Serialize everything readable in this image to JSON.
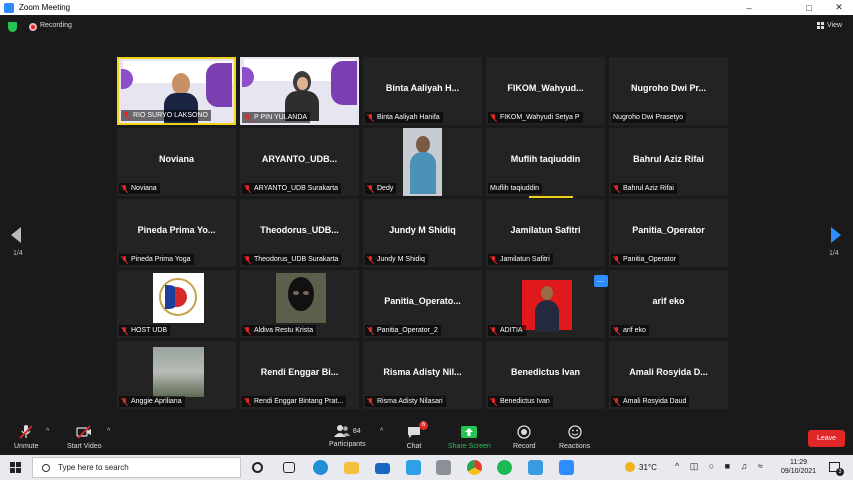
{
  "window": {
    "title": "Zoom Meeting"
  },
  "header": {
    "recording_label": "Recording",
    "view_label": "View"
  },
  "tiles": [
    {
      "big": "",
      "label": "RIO SURYO LAKSONO"
    },
    {
      "big": "",
      "label": "P PIN YULANDA"
    },
    {
      "big": "Binta Aaliyah H...",
      "label": "Binta Aaliyah Hanifa"
    },
    {
      "big": "FIKOM_Wahyud...",
      "label": "FIKOM_Wahyudi Setya P"
    },
    {
      "big": "Nugroho Dwi Pr...",
      "label": "Nugroho Dwi Prasetyo"
    },
    {
      "big": "Noviana",
      "label": "Noviana"
    },
    {
      "big": "ARYANTO_UDB...",
      "label": "ARYANTO_UDB Surakarta"
    },
    {
      "big": "",
      "label": "Dedy"
    },
    {
      "big": "Muflih taqiuddin",
      "label": "Muflih taqiuddin"
    },
    {
      "big": "Bahrul Aziz Rifai",
      "label": "Bahrul Aziz Rifai"
    },
    {
      "big": "Pineda Prima Yo...",
      "label": "Pineda Prima Yoga"
    },
    {
      "big": "Theodorus_UDB...",
      "label": "Theodorus_UDB Surakarta"
    },
    {
      "big": "Jundy M Shidiq",
      "label": "Jundy M Shidiq"
    },
    {
      "big": "Jamilatun Safitri",
      "label": "Jamilatun Safitri"
    },
    {
      "big": "Panitia_Operator",
      "label": "Panitia_Operator"
    },
    {
      "big": "",
      "label": "HOST UDB"
    },
    {
      "big": "",
      "label": "Aldiva Restu Krista"
    },
    {
      "big": "Panitia_Operato...",
      "label": "Panitia_Operator_2"
    },
    {
      "big": "",
      "label": "ADITIA"
    },
    {
      "big": "arif eko",
      "label": "arif eko"
    },
    {
      "big": "",
      "label": "Anggie Apriliana"
    },
    {
      "big": "Rendi Enggar Bi...",
      "label": "Rendi Enggar Bintang Prat..."
    },
    {
      "big": "Risma Adisty Nil...",
      "label": "Risma Adisty Nilasari"
    },
    {
      "big": "Benedictus Ivan",
      "label": "Benedictus Ivan"
    },
    {
      "big": "Amali Rosyida D...",
      "label": "Amali Rosyida Daud"
    }
  ],
  "pager": {
    "left": "1/4",
    "right": "1/4",
    "more": "..."
  },
  "toolbar": {
    "unmute": "Unmute",
    "start_video": "Start Video",
    "participants": "Participants",
    "participants_count": "84",
    "chat": "Chat",
    "chat_badge": "6",
    "share_screen": "Share Screen",
    "record": "Record",
    "reactions": "Reactions",
    "leave": "Leave"
  },
  "taskbar": {
    "search_placeholder": "Type here to search",
    "temperature": "31°C",
    "time": "11:29",
    "date": "09/10/2021",
    "notif_count": "3"
  },
  "colors": {
    "accent": "#2d8cff",
    "danger": "#e02828",
    "active_speaker": "#f2d31c",
    "share": "#23c552"
  }
}
